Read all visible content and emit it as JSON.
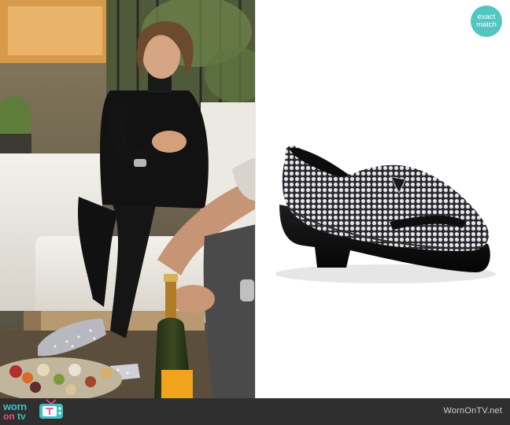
{
  "badge": {
    "line1": "exact",
    "line2": "match"
  },
  "footer": {
    "logo_word1": "worn",
    "logo_word2": "on",
    "logo_word3": "tv",
    "site_url": "WornOnTV.net"
  },
  "icons": [
    "tv-icon"
  ],
  "colors": {
    "badge_bg": "#52c6c0",
    "footer_bg": "#2f2f2f",
    "logo_teal": "#3fc0c0",
    "logo_pink": "#e9518a"
  }
}
